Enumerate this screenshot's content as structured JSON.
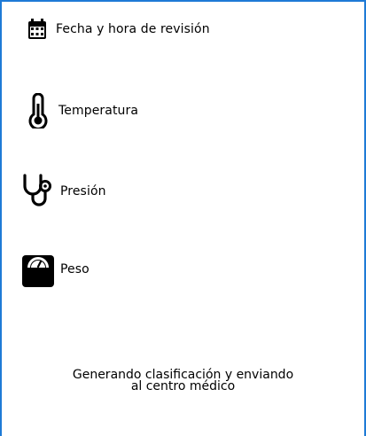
{
  "vitals": {
    "fecha": {
      "label": "Fecha y hora de revisión",
      "icon": "calendar-icon"
    },
    "temperatura": {
      "label": "Temperatura",
      "icon": "thermometer-icon"
    },
    "presion": {
      "label": "Presión",
      "icon": "stethoscope-icon"
    },
    "peso": {
      "label": "Peso",
      "icon": "weighing-scale-icon"
    }
  },
  "status": {
    "line1": "Generando clasificación y enviando",
    "line2": "al centro médico"
  },
  "colors": {
    "frame_border": "#1e7ad6",
    "text": "#000000",
    "icon": "#000000"
  }
}
